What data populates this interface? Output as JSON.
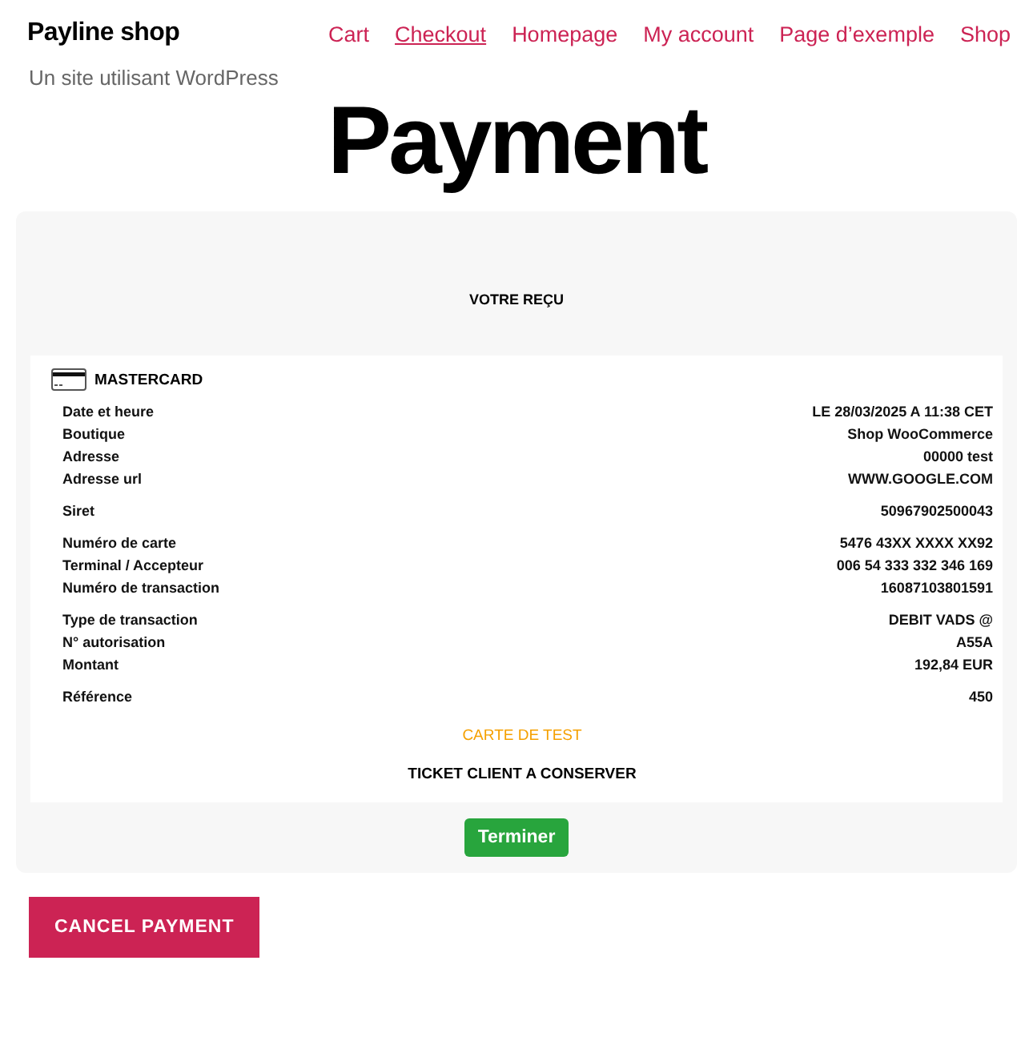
{
  "site": {
    "title": "Payline shop",
    "tagline": "Un site utilisant WordPress"
  },
  "nav": [
    {
      "label": "Cart",
      "selected": false
    },
    {
      "label": "Checkout",
      "selected": true
    },
    {
      "label": "Homepage",
      "selected": false
    },
    {
      "label": "My account",
      "selected": false
    },
    {
      "label": "Page d’exemple",
      "selected": false
    },
    {
      "label": "Shop",
      "selected": false
    }
  ],
  "page_title": "Payment",
  "receipt": {
    "heading": "VOTRE REÇU",
    "card_type": "MASTERCARD",
    "groups": [
      [
        {
          "label": "Date et heure",
          "value": "LE 28/03/2025 A 11:38 CET"
        },
        {
          "label": "Boutique",
          "value": "Shop WooCommerce"
        },
        {
          "label": "Adresse",
          "value": "00000 test"
        },
        {
          "label": "Adresse url",
          "value": "WWW.GOOGLE.COM"
        }
      ],
      [
        {
          "label": "Siret",
          "value": "50967902500043"
        }
      ],
      [
        {
          "label": "Numéro de carte",
          "value": "5476 43XX XXXX XX92"
        },
        {
          "label": "Terminal / Accepteur",
          "value": "006 54 333 332 346 169"
        },
        {
          "label": "Numéro de transaction",
          "value": "16087103801591"
        }
      ],
      [
        {
          "label": "Type de transaction",
          "value": "DEBIT VADS @"
        },
        {
          "label": "N° autorisation",
          "value": "A55A"
        },
        {
          "label": "Montant",
          "value": "192,84 EUR"
        }
      ],
      [
        {
          "label": "Référence",
          "value": "450"
        }
      ]
    ],
    "test_notice": "CARTE DE TEST",
    "footer": "TICKET CLIENT A CONSERVER",
    "finish_button": "Terminer"
  },
  "cancel_button": "CANCEL PAYMENT"
}
